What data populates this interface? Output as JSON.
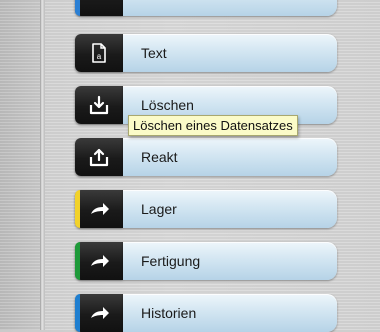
{
  "rows": [
    {
      "label": "",
      "icon": "partial-item-icon",
      "stripe_color": "#2a7fd4"
    },
    {
      "label": "Text",
      "icon": "document-a-icon",
      "stripe_color": ""
    },
    {
      "label": "Löschen",
      "icon": "tray-download-icon",
      "stripe_color": ""
    },
    {
      "label": "Reakt",
      "icon": "tray-upload-icon",
      "stripe_color": ""
    },
    {
      "label": "Lager",
      "icon": "arrow-right-icon",
      "stripe_color": "#f2d22a"
    },
    {
      "label": "Fertigung",
      "icon": "arrow-right-icon",
      "stripe_color": "#1e9a3a"
    },
    {
      "label": "Historien",
      "icon": "arrow-right-icon",
      "stripe_color": "#1f7fd0"
    }
  ],
  "tooltip": {
    "text": "Löschen eines Datensatzes"
  }
}
